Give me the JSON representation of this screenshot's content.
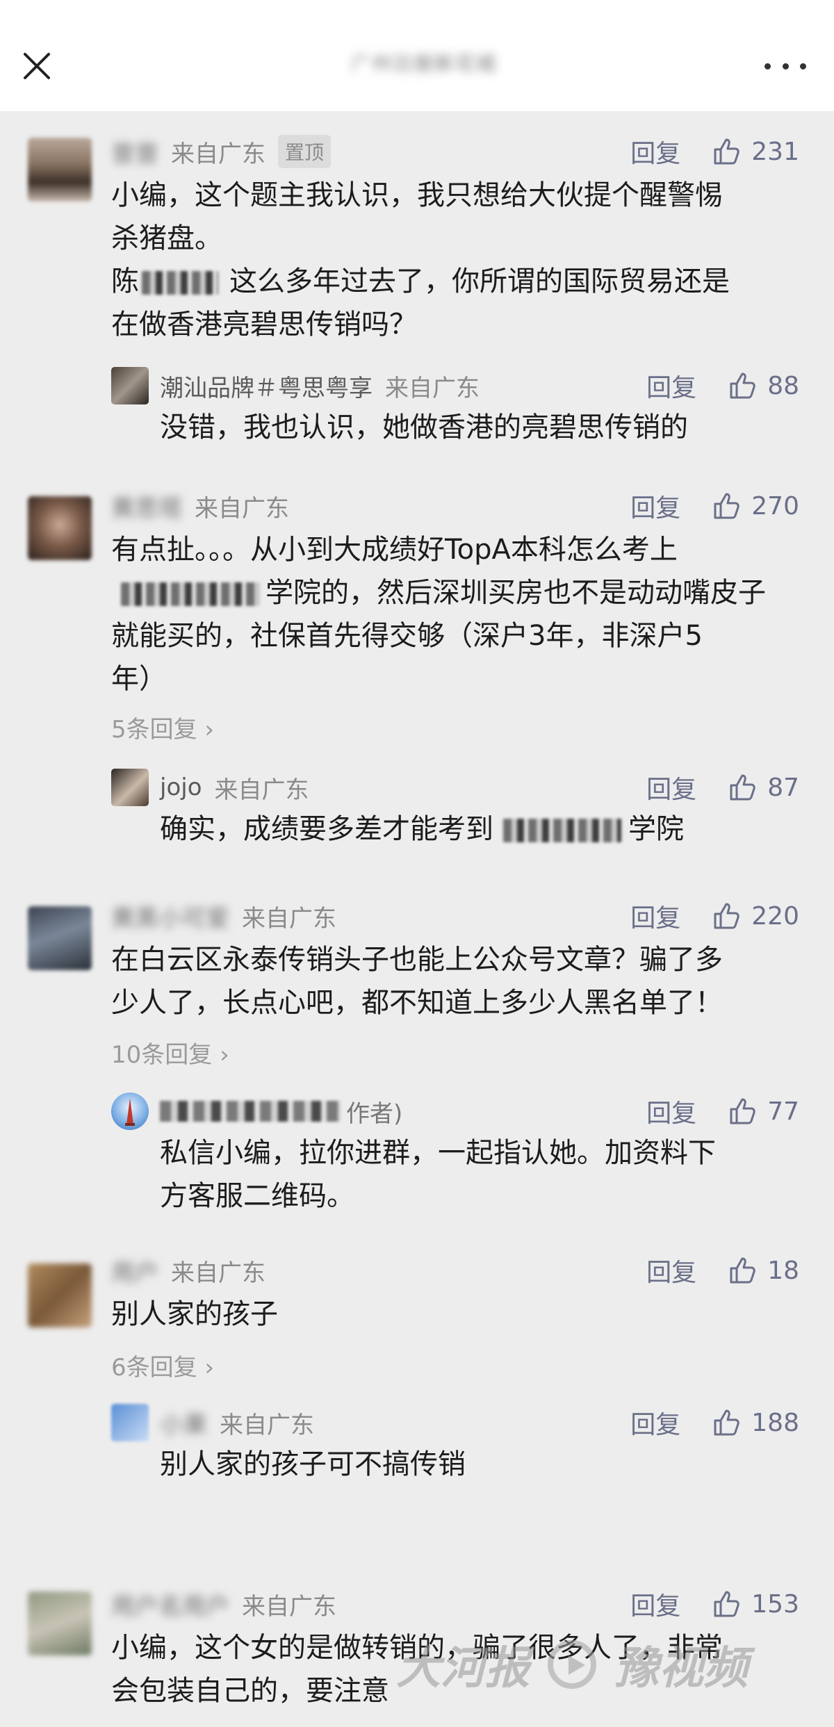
{
  "header": {
    "title_blurred": "广州日报新花城",
    "close_icon": "close-icon",
    "more_icon": "more-icon"
  },
  "comments": [
    {
      "name": "曾曾",
      "name_blurred": true,
      "location": "来自广东",
      "pin": "置顶",
      "reply": "回复",
      "likes": "231",
      "text_lines": [
        "小编，这个题主我认识，我只想给大伙提个醒警惕",
        "杀猪盘。"
      ],
      "text_line3_prefix": "陈",
      "text_line3_suffix": "这么多年过去了，你所谓的国际贸易还是",
      "text_line4": "在做香港亮碧思传销吗？",
      "reply_item": {
        "name": "潮汕品牌＃粤思粤享",
        "location": "来自广东",
        "reply": "回复",
        "likes": "88",
        "text": "没错，我也认识，她做香港的亮碧思传销的"
      }
    },
    {
      "name": "黄思塔",
      "name_blurred": true,
      "location": "来自广东",
      "reply": "回复",
      "likes": "270",
      "line1": "有点扯。。。从小到大成绩好TopA本科怎么考上",
      "line2_suffix": "学院的，然后深圳买房也不是动动嘴皮子",
      "line3": "就能买的，社保首先得交够（深户3年，非深户5",
      "line4": "年）",
      "more_replies": "5条回复",
      "reply_item": {
        "name": "jojo",
        "location": "来自广东",
        "reply": "回复",
        "likes": "87",
        "text_prefix": "确实，成绩要多差才能考到",
        "text_suffix": "学院"
      }
    },
    {
      "name": "黄黑小可爱",
      "name_blurred": true,
      "location": "来自广东",
      "reply": "回复",
      "likes": "220",
      "line1": "在白云区永泰传销头子也能上公众号文章？骗了多",
      "line2": "少人了，长点心吧，都不知道上多少人黑名单了！",
      "more_replies": "10条回复",
      "reply_item": {
        "name": "新花城(作者)",
        "name_visible": "作者)",
        "location": "",
        "reply": "回复",
        "likes": "77",
        "line1": "私信小编，拉你进群，一起指认她。加资料下",
        "line2": "方客服二维码。"
      }
    },
    {
      "name": "用户",
      "name_blurred": true,
      "location": "来自广东",
      "reply": "回复",
      "likes": "18",
      "line1": "别人家的孩子",
      "more_replies": "6条回复",
      "reply_item": {
        "name": "小果",
        "location": "来自广东",
        "reply": "回复",
        "likes": "188",
        "text": "别人家的孩子可不搞传销"
      }
    },
    {
      "name": "用户名用户",
      "name_blurred": true,
      "location": "来自广东",
      "reply": "回复",
      "likes": "153",
      "line1": "小编，这个女的是做转销的，骗了很多人了，非常",
      "line2": "会包装自己的，要注意"
    }
  ],
  "watermark": {
    "left": "大河报",
    "right": "豫视频"
  },
  "colors": {
    "background": "#ededed",
    "action": "#6a6f89",
    "meta": "#8a8a8a"
  }
}
